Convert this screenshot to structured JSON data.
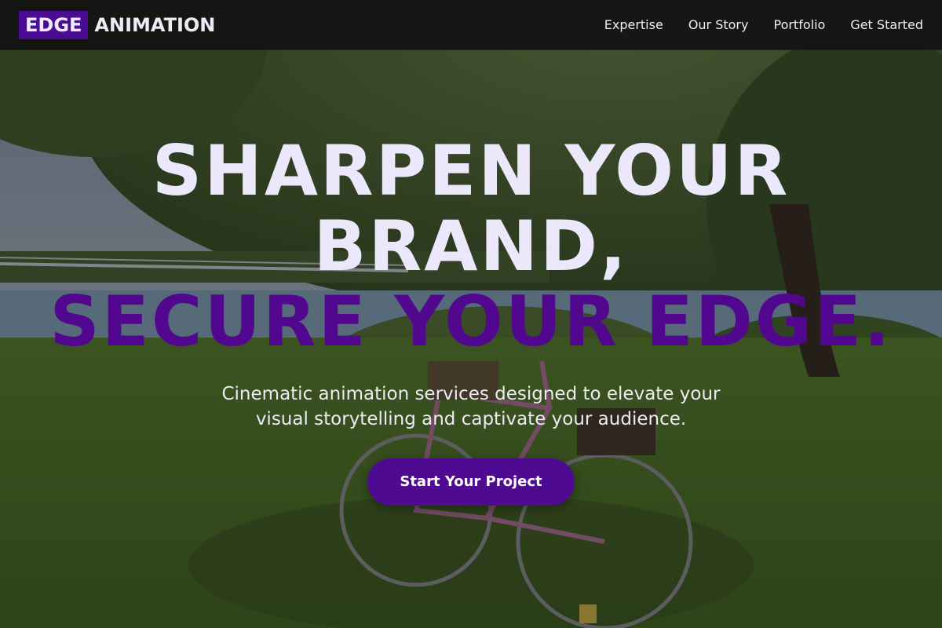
{
  "brand": {
    "logo_box_text": "EDGE",
    "logo_text": "ANIMATION"
  },
  "nav": {
    "items": [
      {
        "label": "Expertise"
      },
      {
        "label": "Our Story"
      },
      {
        "label": "Portfolio"
      },
      {
        "label": "Get Started"
      }
    ]
  },
  "hero": {
    "headline_line1": "SHARPEN YOUR",
    "headline_line2": "BRAND,",
    "headline_line3": "SECURE YOUR EDGE.",
    "subtitle": "Cinematic animation services designed to elevate your visual storytelling and captivate your audience.",
    "cta_label": "Start Your Project",
    "background_description": "landscape-photo"
  },
  "colors": {
    "accent": "#4e0a91",
    "navbar_bg": "#121214",
    "headline_light": "#ebe8fb"
  }
}
